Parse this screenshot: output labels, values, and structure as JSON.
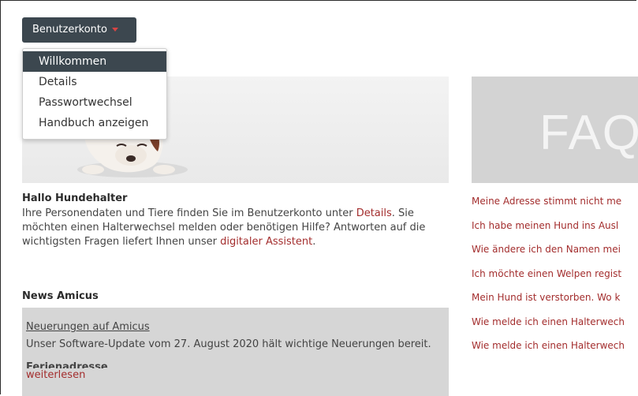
{
  "account_menu": {
    "button_label": "Benutzerkonto",
    "items": [
      "Willkommen",
      "Details",
      "Passwortwechsel",
      "Handbuch anzeigen"
    ]
  },
  "welcome": {
    "title": "Hallo Hundehalter",
    "text_1": "Ihre Personendaten und Tiere finden Sie im Benutzerkonto unter ",
    "link_details": "Details",
    "text_2": ". Sie möchten einen Halterwechsel melden oder benötigen Hilfe? Antworten auf die wichtigsten Fragen liefert Ihnen unser ",
    "link_assistant": "digitaler Assistent",
    "text_3": "."
  },
  "news": {
    "title": "News Amicus",
    "item_link": "Neuerungen auf Amicus",
    "item_text": "Unser Software-Update vom 27. August 2020 hält wichtige Neuerungen bereit.",
    "second_title": "Ferienadresse",
    "more": "weiterlesen"
  },
  "faq": {
    "banner": "FAQ",
    "items": [
      "Meine Adresse stimmt nicht me",
      "Ich habe meinen Hund ins Ausl",
      "Wie ändere ich den Namen mei",
      "Ich möchte einen Welpen regist",
      "Mein Hund ist verstorben. Wo k",
      "Wie melde ich einen Halterwech",
      "Wie melde ich einen Halterwech"
    ]
  },
  "colors": {
    "button_bg": "#3c474f",
    "link": "#a32d2d",
    "panel_gray": "#d6d6d6"
  }
}
